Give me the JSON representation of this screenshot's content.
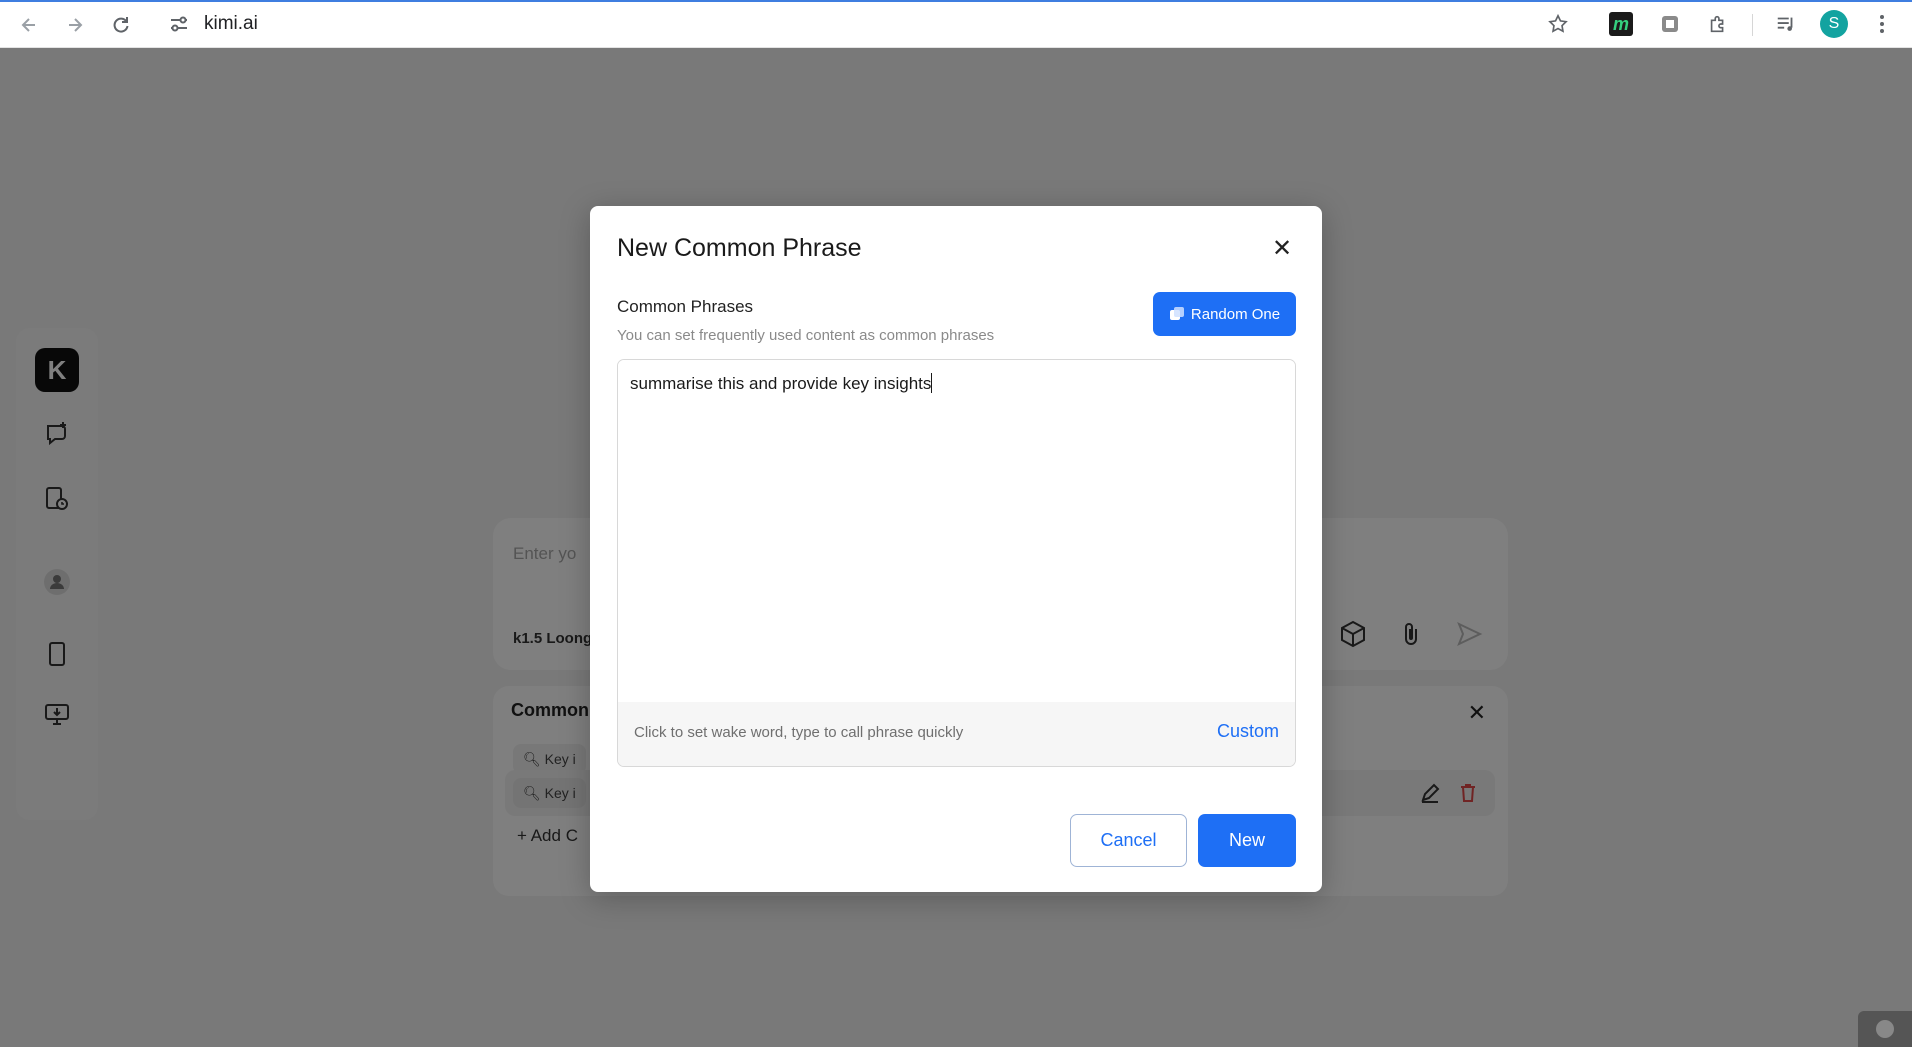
{
  "browser": {
    "url": "kimi.ai",
    "profile_initial": "S",
    "extension_m": "m"
  },
  "sidebar": {
    "logo": "K"
  },
  "chat": {
    "placeholder": "Enter yo",
    "model": "k1.5 Loong"
  },
  "phrases_panel": {
    "title": "Common",
    "chips": [
      "Key i",
      "Key i"
    ],
    "add_label": "Add C"
  },
  "modal": {
    "title": "New Common Phrase",
    "field_label": "Common Phrases",
    "field_hint": "You can set frequently used content as common phrases",
    "random_label": "Random One",
    "text_value": "summarise this and provide key insights",
    "wake_hint": "Click to set wake word, type to call phrase quickly",
    "custom_label": "Custom",
    "cancel_label": "Cancel",
    "new_label": "New"
  },
  "colors": {
    "accent": "#1e6ff5",
    "overlay": "#00000080"
  }
}
